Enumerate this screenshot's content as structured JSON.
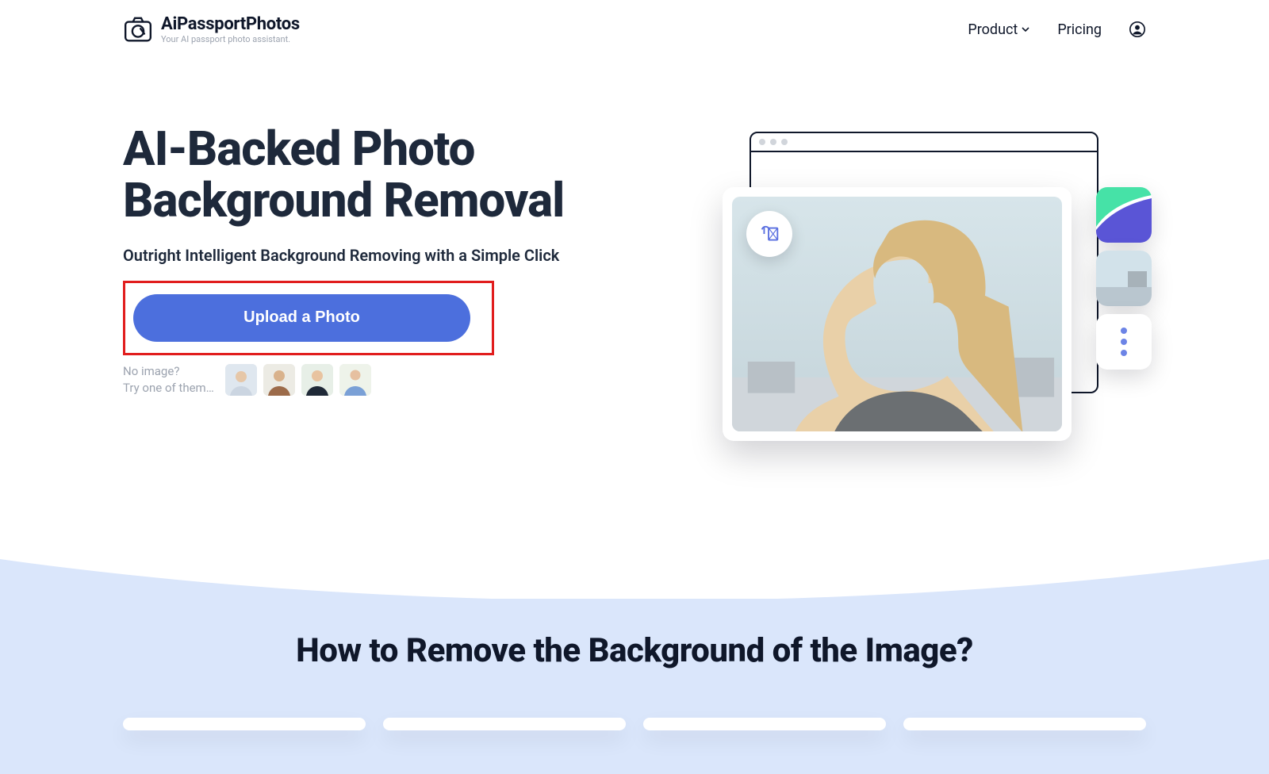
{
  "brand": {
    "name": "AiPassportPhotos",
    "tagline": "Your AI passport photo assistant."
  },
  "nav": {
    "product": "Product",
    "pricing": "Pricing"
  },
  "hero": {
    "title": "AI-Backed Photo Background Removal",
    "subtitle": "Outright Intelligent Background Removing with a Simple Click",
    "upload_label": "Upload a Photo",
    "samples_line1": "No image?",
    "samples_line2": "Try one of them…"
  },
  "section2": {
    "title": "How to Remove the Background of the Image?"
  }
}
